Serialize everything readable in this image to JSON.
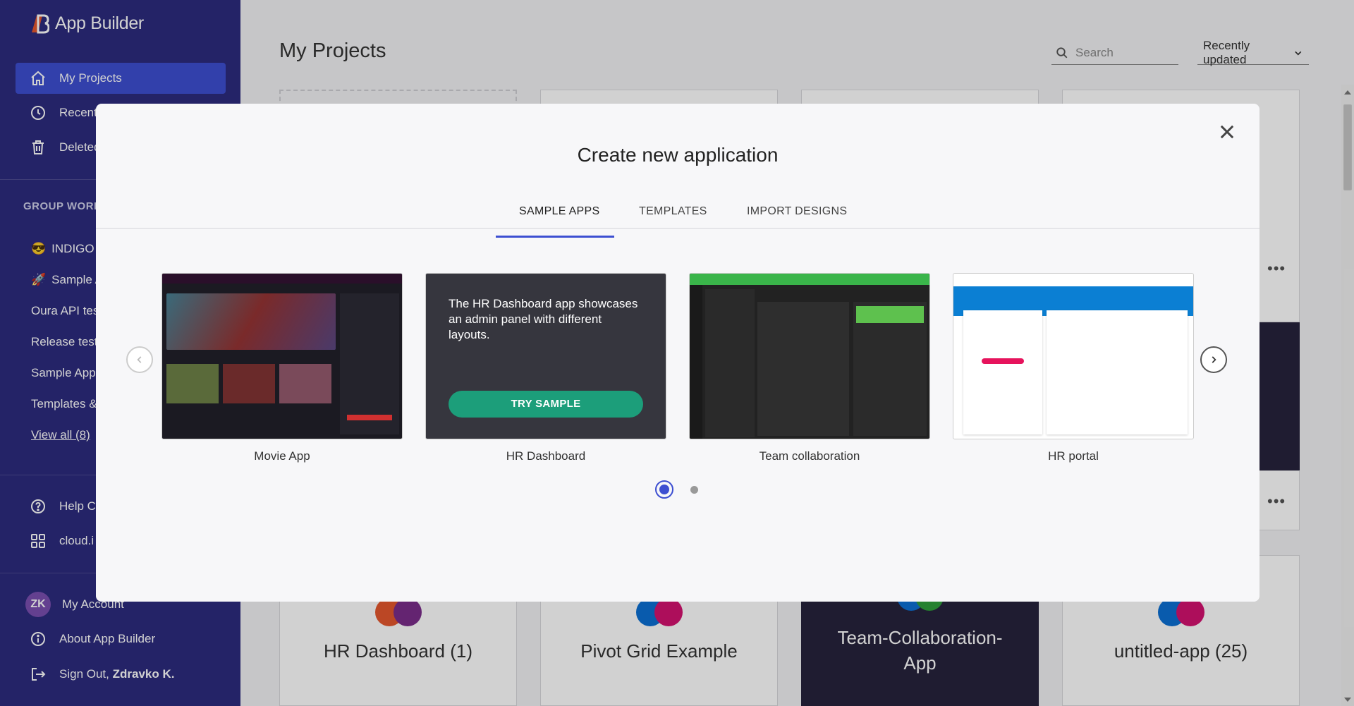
{
  "app": {
    "title": "App Builder"
  },
  "sidebar": {
    "nav": [
      {
        "label": "My Projects",
        "icon": "home-icon"
      },
      {
        "label": "Recent",
        "icon": "clock-icon"
      },
      {
        "label": "Deleted",
        "icon": "trash-icon"
      }
    ],
    "group_title": "GROUP WORK",
    "workspaces": [
      {
        "label": "INDIGO A",
        "icon": "😎"
      },
      {
        "label": "Sample A",
        "icon": "🚀"
      },
      {
        "label": "Oura API tes"
      },
      {
        "label": "Release test"
      },
      {
        "label": "Sample App"
      },
      {
        "label": "Templates &"
      }
    ],
    "view_all": "View all (8)",
    "help": "Help C",
    "cloud": "cloud.i",
    "account": {
      "initials": "ZK",
      "label": "My Account"
    },
    "about": "About App Builder",
    "signout_prefix": "Sign Out,",
    "signout_name": "Zdravko K."
  },
  "main": {
    "title": "My Projects",
    "search_placeholder": "Search",
    "sort_label": "Recently updated",
    "cards": [
      {
        "title": "HR Dashboard (1)"
      },
      {
        "title": "Pivot Grid Example"
      },
      {
        "title_line1": "Team-Collaboration-",
        "title_line2": "App"
      },
      {
        "title": "untitled-app (25)"
      }
    ]
  },
  "modal": {
    "title": "Create new application",
    "tabs": [
      "SAMPLE APPS",
      "TEMPLATES",
      "IMPORT DESIGNS"
    ],
    "samples": [
      {
        "label": "Movie App"
      },
      {
        "label": "HR Dashboard",
        "description": "The HR Dashboard app showcases an admin panel with different layouts.",
        "button": "TRY SAMPLE"
      },
      {
        "label": "Team collaboration"
      },
      {
        "label": "HR portal"
      }
    ],
    "colors": {
      "accent": "#3d4fd1",
      "try_button": "#1c9e7a"
    }
  }
}
